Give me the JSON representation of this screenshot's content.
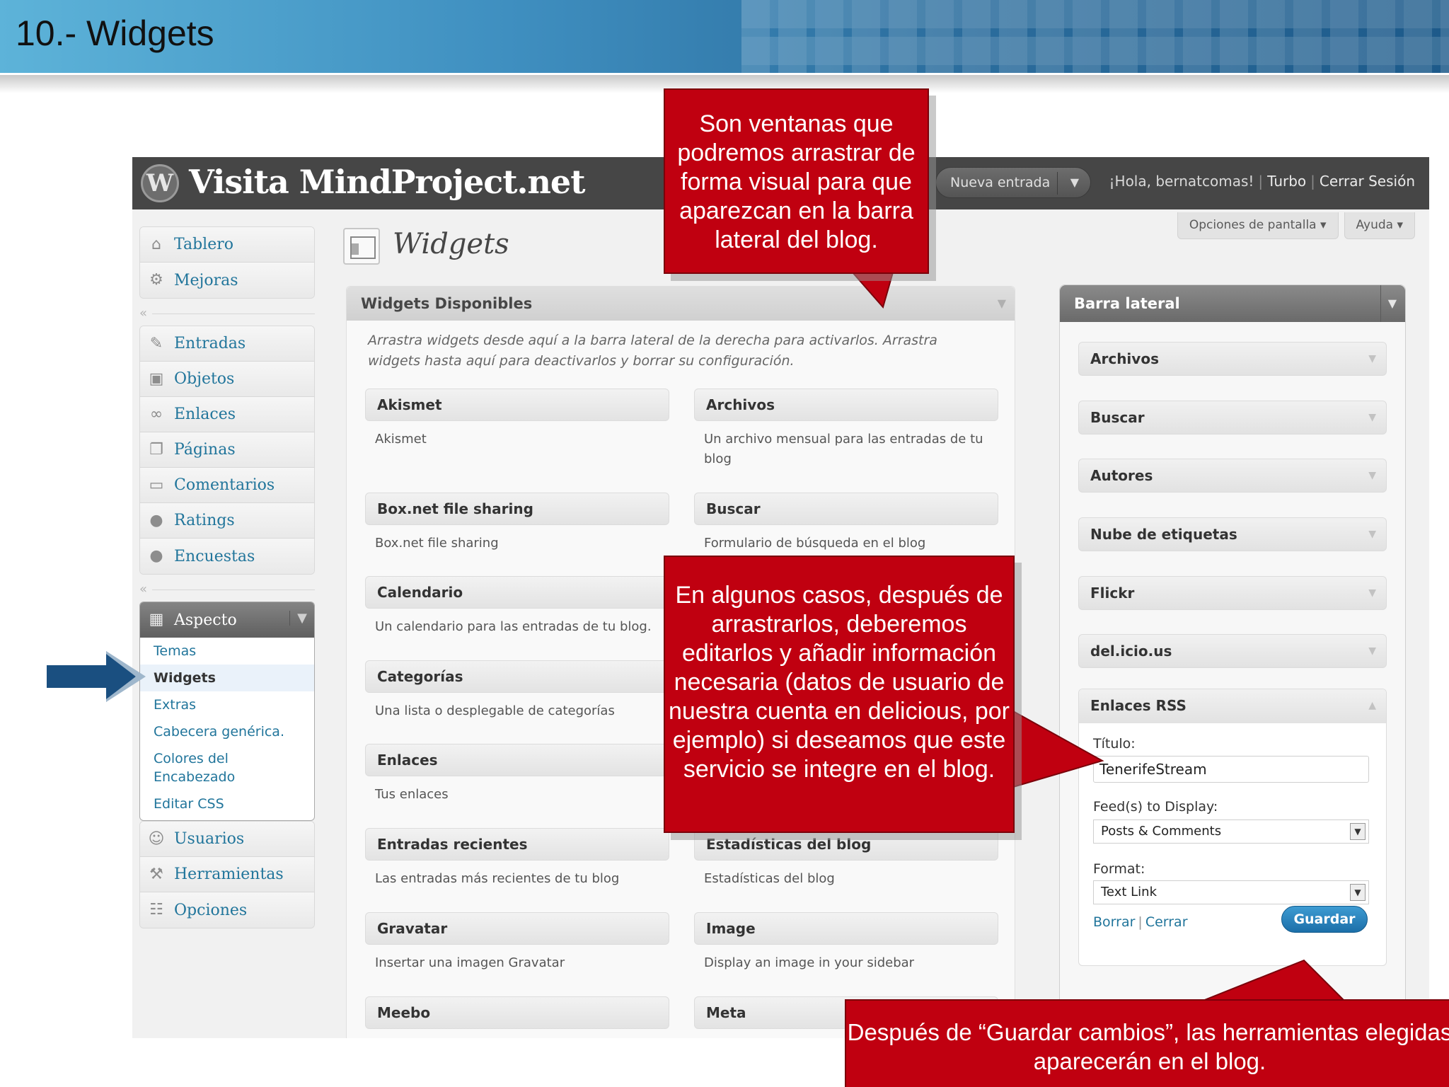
{
  "slide": {
    "title": "10.- Widgets"
  },
  "header": {
    "site_title": "Visita MindProject.net",
    "new_entry": "Nueva entrada",
    "greeting": "¡Hola, bernatcomas!",
    "turbo": "Turbo",
    "logout": "Cerrar Sesión",
    "screen_options": "Opciones de pantalla",
    "help": "Ayuda"
  },
  "menu": {
    "group1": [
      {
        "label": "Tablero",
        "icon": "home-icon"
      },
      {
        "label": "Mejoras",
        "icon": "gear-icon"
      }
    ],
    "group2": [
      {
        "label": "Entradas",
        "icon": "pin-icon"
      },
      {
        "label": "Objetos",
        "icon": "media-icon"
      },
      {
        "label": "Enlaces",
        "icon": "link-icon"
      },
      {
        "label": "Páginas",
        "icon": "pages-icon"
      },
      {
        "label": "Comentarios",
        "icon": "comment-icon"
      },
      {
        "label": "Ratings",
        "icon": "ratings-icon"
      },
      {
        "label": "Encuestas",
        "icon": "polls-icon"
      }
    ],
    "appearance": {
      "label": "Aspecto",
      "submenu": [
        "Temas",
        "Widgets",
        "Extras",
        "Cabecera genérica.",
        "Colores del Encabezado",
        "Editar CSS"
      ]
    },
    "group3": [
      {
        "label": "Usuarios",
        "icon": "users-icon"
      },
      {
        "label": "Herramientas",
        "icon": "tools-icon"
      },
      {
        "label": "Opciones",
        "icon": "settings-icon"
      }
    ]
  },
  "page": {
    "title": "Widgets"
  },
  "available": {
    "heading": "Widgets Disponibles",
    "description": "Arrastra widgets desde aquí a la barra lateral de la derecha para activarlos. Arrastra widgets hasta aquí para deactivarlos y borrar su configuración.",
    "widgets": [
      {
        "title": "Akismet",
        "desc": "Akismet"
      },
      {
        "title": "Archivos",
        "desc": "Un archivo mensual para las entradas de tu blog"
      },
      {
        "title": "Box.net file sharing",
        "desc": "Box.net file sharing"
      },
      {
        "title": "Buscar",
        "desc": "Formulario de búsqueda en el blog"
      },
      {
        "title": "Calendario",
        "desc": "Un calendario para las entradas de tu blog."
      },
      {
        "title": "",
        "desc": ""
      },
      {
        "title": "Categorías",
        "desc": "Una lista o desplegable de categorías"
      },
      {
        "title": "",
        "desc": ""
      },
      {
        "title": "Enlaces",
        "desc": "Tus enlaces"
      },
      {
        "title": "",
        "desc": ""
      },
      {
        "title": "Entradas recientes",
        "desc": "Las entradas más recientes de tu blog"
      },
      {
        "title": "Estadísticas del blog",
        "desc": "Estadísticas del blog"
      },
      {
        "title": "Gravatar",
        "desc": "Insertar una imagen Gravatar"
      },
      {
        "title": "Image",
        "desc": "Display an image in your sidebar"
      },
      {
        "title": "Meebo",
        "desc": ""
      },
      {
        "title": "Meta",
        "desc": ""
      }
    ]
  },
  "sidebar": {
    "heading": "Barra lateral",
    "items": [
      "Archivos",
      "Buscar",
      "Autores",
      "Nube de etiquetas",
      "Flickr",
      "del.icio.us"
    ],
    "rss": {
      "title": "Enlaces RSS",
      "title_label": "Título:",
      "title_value": "TenerifeStream",
      "feeds_label": "Feed(s) to Display:",
      "feeds_value": "Posts & Comments",
      "format_label": "Format:",
      "format_value": "Text Link",
      "delete": "Borrar",
      "close": "Cerrar",
      "save": "Guardar"
    }
  },
  "callouts": {
    "c1": "Son ventanas que podremos arrastrar de forma visual para que aparezcan en la barra lateral del blog.",
    "c2": "En algunos casos, después de arrastrarlos, deberemos editarlos y añadir información necesaria (datos de usuario de nuestra cuenta en delicious, por ejemplo) si deseamos que este servicio se integre en el blog.",
    "c3": "Después de  “Guardar cambios”, las herramientas elegidas  aparecerán en el blog."
  },
  "colors": {
    "callout": "#c00010",
    "arrow": "#1a4f80",
    "link": "#21759b"
  }
}
